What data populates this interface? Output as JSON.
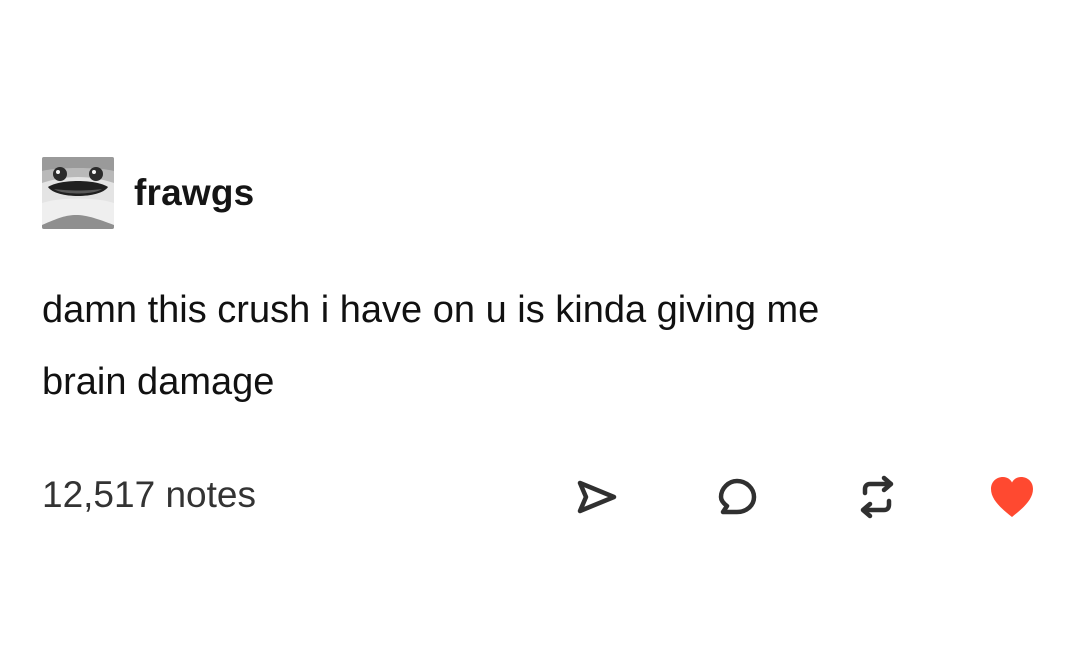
{
  "post": {
    "username": "frawgs",
    "text_line1": "damn this crush i have on u is kinda giving me",
    "text_line2": "brain damage",
    "notes": "12,517 notes"
  },
  "icons": {
    "share": "share-icon",
    "reply": "reply-icon",
    "reblog": "reblog-icon",
    "like": "heart-icon"
  },
  "colors": {
    "text": "#111111",
    "icon": "#303030",
    "like": "#ff4930"
  }
}
